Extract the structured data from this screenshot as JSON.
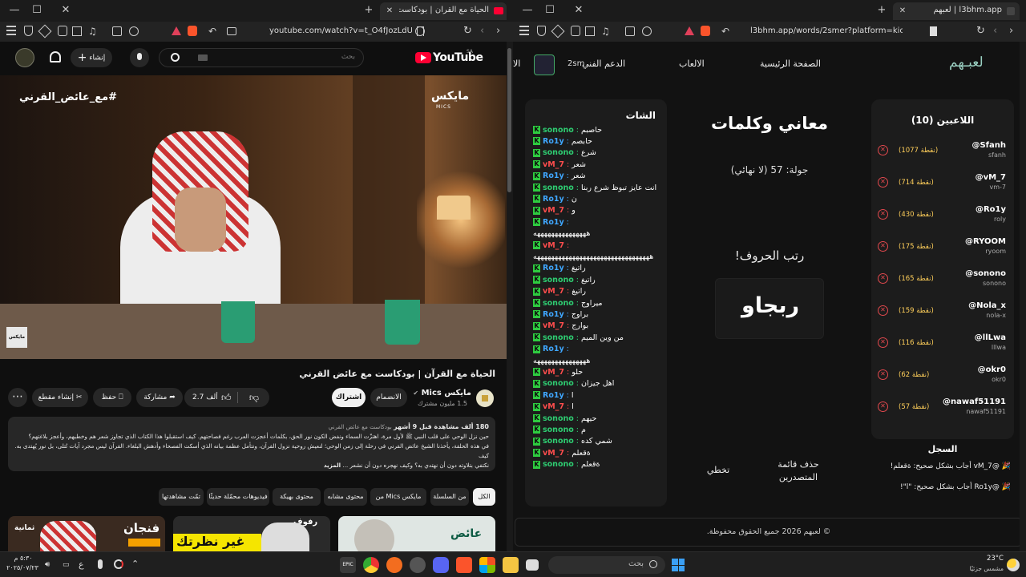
{
  "left_browser": {
    "tab_title": "الحياة مع القرآن | بودكاست مع ...",
    "url": "youtube.com/watch?v=t_O4fJozLdU",
    "youtube": {
      "logo_text": "YouTube",
      "logo_region": "SA",
      "search_placeholder": "بحث",
      "create_label": "إنشاء",
      "video_overlay_tag": "#مع_عائض_القرني",
      "video_overlay_brand": "مايكس",
      "video_overlay_brand_sub": "MICS",
      "watermark": "مايكس",
      "video_title": "الحياة مع القرآن | بودكاست مع عائض القرني",
      "channel_name": "مايكس Mics",
      "channel_subs": "1.5 مليون مشترك",
      "join_label": "الانضمام",
      "subscribe_label": "اشتراك",
      "likes": "2.7 ألف",
      "share_label": "مشاركة",
      "save_label": "حفظ",
      "clip_label": "إنشاء مقطع",
      "desc_meta": "180 ألف مشاهدة قبل 9 أشهر",
      "desc_tags": "بودكاست مع عائض القرني",
      "desc_line1": "حين نزل الوحي على قلب النبي ﷺ لأول مرة، اهتزّت السماء ونفض الكون نور الحق، بكلمات أعجزت العرب رغم فصاحتهم. كيف استقبلوا هذا الكتاب الذي تجاوز شعر هم وخطبهم، وأعجز بلاغتهم؟",
      "desc_line2": "في هذه الحلقة، يأخذنا الشيخ عائض القرني في رحلة إلى زمن الوحي؛ لنعيش روحية نزول القرآن، ونتأمل عظمة بيانه الذي أسكت الفصحاء وأدهش البلغاء. القرآن ليس مجرد آيات تُتلى، بل نور يُهتدى به. كيف",
      "desc_line3": "نكتفي بتلاوته دون أن نهتدي به؟ وكيف نهجره دون أن نشعر ...",
      "desc_more": "المزيد",
      "chips": [
        "الكل",
        "من السلسلة",
        "من Mics مايكس",
        "محتوى مشابه",
        "محتوى بهيكة",
        "فيديوهات محمّلة حديثًا",
        "تمّت مشاهدتها"
      ],
      "thumb1_text": "عائض",
      "thumb2_text": "رفوف",
      "thumb2_big": "غير نظرتك",
      "thumb3_text": "فنجان",
      "thumb3_sub": "ثمانية"
    }
  },
  "right_browser": {
    "tab_title": "l3bhm.app | لعبهم",
    "url": "l3bhm.app/words/2smer?platform=kick",
    "site": {
      "logo": "لعبـهم",
      "nav": [
        "الصفحة الرئيسية",
        "الالعاب",
        "الدعم الفني",
        "الا"
      ],
      "user_name": "2sm",
      "players_title": "اللاعبين (10)",
      "players": [
        {
          "name": "@Sfanh",
          "user": "sfanh",
          "points": "(1077 نقطة)"
        },
        {
          "name": "@vM_7",
          "user": "vm-7",
          "points": "(714 نقطة)"
        },
        {
          "name": "@Ro1y",
          "user": "roly",
          "points": "(430 نقطة)"
        },
        {
          "name": "@RYOOM",
          "user": "ryoom",
          "points": "(175 نقطة)"
        },
        {
          "name": "@sonono",
          "user": "sonono",
          "points": "(165 نقطة)"
        },
        {
          "name": "@Nola_x",
          "user": "nola-x",
          "points": "(159 نقطة)"
        },
        {
          "name": "@llLwa",
          "user": "lllwa",
          "points": "(116 نقطة)"
        },
        {
          "name": "@okr0",
          "user": "okr0",
          "points": "(62 نقطة)"
        },
        {
          "name": "@nawaf51191",
          "user": "nawaf51191",
          "points": "(57 نقطة)"
        }
      ],
      "game_title": "معاني وكلمات",
      "round": "جولة: 57 (لا نهائي)",
      "prompt": "رتب الحروف!",
      "scrambled": "ربجاو",
      "delete_leaderboard": "حذف قائمة المتصدرين",
      "skip": "تخطي",
      "log_title": "السجل",
      "log": [
        "🎉 @vM_7 أجاب بشكل صحيح: ةقعلم!",
        "🎉 @Ro1y أجاب بشكل صحيح: \"ا\"!"
      ],
      "chat_title": "الشات",
      "chat": [
        {
          "user": "sonono",
          "msg": "حاصبم",
          "color": "#2ecc71"
        },
        {
          "user": "Ro1y",
          "msg": "حابصم",
          "color": "#3fa7ff"
        },
        {
          "user": "sonono",
          "msg": "شرع",
          "color": "#2ecc71"
        },
        {
          "user": "vM_7",
          "msg": "شعر",
          "color": "#ff4d4d"
        },
        {
          "user": "Ro1y",
          "msg": "شعر",
          "color": "#3fa7ff"
        },
        {
          "user": "sonono",
          "msg": "انت عايز تبوظ شرع ربنا",
          "color": "#2ecc71"
        },
        {
          "user": "Ro1y",
          "msg": "ن",
          "color": "#3fa7ff"
        },
        {
          "user": "vM_7",
          "msg": "و",
          "color": "#ff4d4d"
        },
        {
          "user": "Ro1y",
          "msg": "",
          "color": "#3fa7ff"
        },
        {
          "user": "",
          "msg": "هههههههههههههههه",
          "color": "#fff"
        },
        {
          "user": "vM_7",
          "msg": "",
          "color": "#ff4d4d"
        },
        {
          "user": "",
          "msg": "هههههههههههههههههههههههههههههههههه",
          "color": "#fff"
        },
        {
          "user": "Ro1y",
          "msg": "راتيغ",
          "color": "#3fa7ff"
        },
        {
          "user": "sonono",
          "msg": "راتيغ",
          "color": "#2ecc71"
        },
        {
          "user": "vM_7",
          "msg": "راتيغ",
          "color": "#ff4d4d"
        },
        {
          "user": "sonono",
          "msg": "ميراوج",
          "color": "#2ecc71"
        },
        {
          "user": "Ro1y",
          "msg": "براوج",
          "color": "#3fa7ff"
        },
        {
          "user": "vM_7",
          "msg": "بوارج",
          "color": "#ff4d4d"
        },
        {
          "user": "sonono",
          "msg": "من وين الميم",
          "color": "#2ecc71"
        },
        {
          "user": "Ro1y",
          "msg": "",
          "color": "#3fa7ff"
        },
        {
          "user": "",
          "msg": "هههههههههههههههه",
          "color": "#fff"
        },
        {
          "user": "vM_7",
          "msg": "حلو",
          "color": "#ff4d4d"
        },
        {
          "user": "sonono",
          "msg": "اهل جيزان",
          "color": "#2ecc71"
        },
        {
          "user": "Ro1y",
          "msg": "ا",
          "color": "#3fa7ff"
        },
        {
          "user": "vM_7",
          "msg": "ا",
          "color": "#ff4d4d"
        },
        {
          "user": "sonono",
          "msg": "حيهم",
          "color": "#2ecc71"
        },
        {
          "user": "sonono",
          "msg": "م",
          "color": "#2ecc71"
        },
        {
          "user": "sonono",
          "msg": "شمي كده",
          "color": "#2ecc71"
        },
        {
          "user": "vM_7",
          "msg": "ةقعلم",
          "color": "#ff4d4d"
        },
        {
          "user": "sonono",
          "msg": "ةقعلم",
          "color": "#2ecc71"
        }
      ],
      "footer": "© لعبهم 2026 جميع الحقوق محفوظة."
    }
  },
  "taskbar": {
    "search_placeholder": "بحث",
    "weather_temp": "23°C",
    "weather_desc": "مشمس جزئيًا",
    "time": "٥:٣٠ م",
    "date": "٢٠٢٥/٠٧/٢٣",
    "lang": "ع"
  },
  "colors": {
    "youtube_red": "#ff0033",
    "kick_green": "#2ecc40",
    "points_gold": "#ffcf5a",
    "delete_red": "#e0484d"
  }
}
